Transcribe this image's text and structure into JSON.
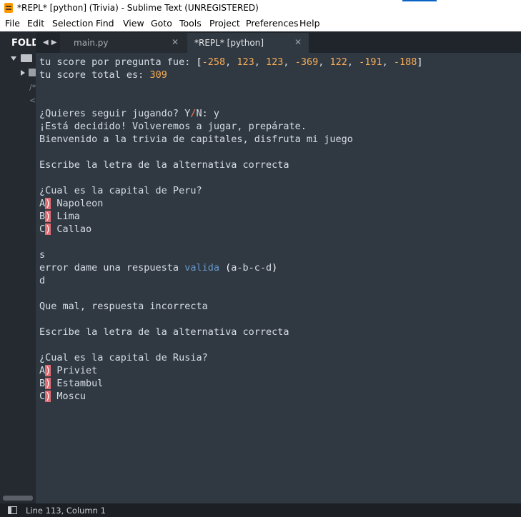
{
  "window": {
    "title": "*REPL* [python] (Trivia) - Sublime Text (UNREGISTERED)"
  },
  "menu": [
    "File",
    "Edit",
    "Selection",
    "Find",
    "View",
    "Goto",
    "Tools",
    "Project",
    "Preferences",
    "Help"
  ],
  "sidebar": {
    "header": "FOLDERS",
    "marks": [
      "/*",
      "<"
    ]
  },
  "tabs": [
    {
      "label": "main.py",
      "active": false
    },
    {
      "label": "*REPL* [python]",
      "active": true
    }
  ],
  "editor": {
    "lines": [
      "tu score por pregunta fue: [-258, 123, 123, -369, 122, -191, -188]",
      "tu score total es: 309",
      "",
      "",
      "¿Quieres seguir jugando? Y/N: y",
      "¡Está decidido! Volveremos a jugar, prepárate.",
      "Bienvenido a la trivia de capitales, disfruta mi juego",
      "",
      "Escribe la letra de la alternativa correcta",
      "",
      "¿Cual es la capital de Peru?",
      "A) Napoleon",
      "B) Lima",
      "C) Callao",
      "",
      "s",
      "error dame una respuesta valida (a-b-c-d)",
      "d",
      "",
      "Que mal, respuesta incorrecta",
      "",
      "Escribe la letra de la alternativa correcta",
      "",
      "¿Cual es la capital de Rusia?",
      "A) Priviet",
      "B) Estambul",
      "C) Moscu"
    ]
  },
  "statusbar": {
    "position": "Line 113, Column 1"
  },
  "colors": {
    "editor_bg": "#303841",
    "text": "#d8dee9",
    "number": "#f9ae58",
    "keyword": "#6699cc",
    "error_highlight": "#e06c75"
  }
}
